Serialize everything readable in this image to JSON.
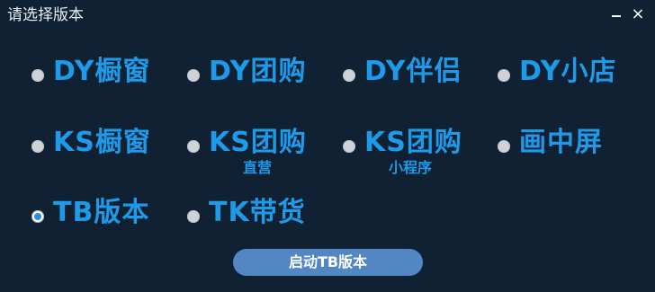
{
  "window": {
    "title": "请选择版本",
    "minimize_symbol": "–",
    "close_symbol": "×"
  },
  "options": [
    {
      "label": "DY橱窗",
      "sub": "",
      "selected": false
    },
    {
      "label": "DY团购",
      "sub": "",
      "selected": false
    },
    {
      "label": "DY伴侣",
      "sub": "",
      "selected": false
    },
    {
      "label": "DY小店",
      "sub": "",
      "selected": false
    },
    {
      "label": "KS橱窗",
      "sub": "",
      "selected": false
    },
    {
      "label": "KS团购",
      "sub": "直营",
      "selected": false
    },
    {
      "label": "KS团购",
      "sub": "小程序",
      "selected": false
    },
    {
      "label": "画中屏",
      "sub": "",
      "selected": false
    },
    {
      "label": "TB版本",
      "sub": "",
      "selected": true
    },
    {
      "label": "TK带货",
      "sub": "",
      "selected": false
    }
  ],
  "start_button": {
    "label": "启动TB版本"
  },
  "colors": {
    "background": "#0f2133",
    "accent": "#1f9ae8",
    "button": "#5287c4"
  }
}
